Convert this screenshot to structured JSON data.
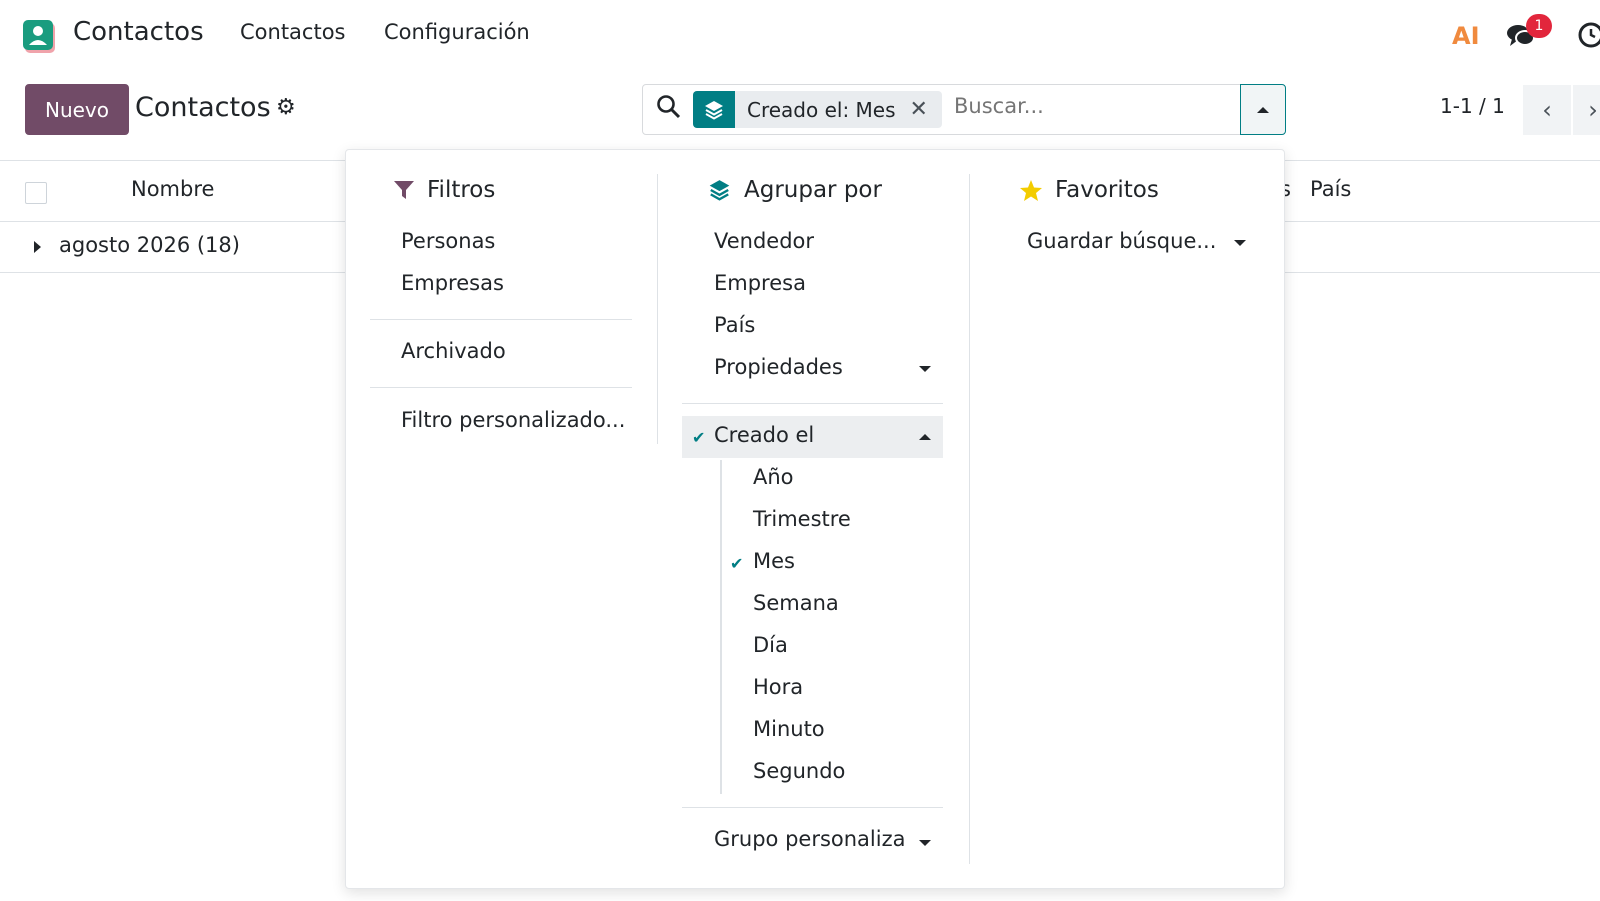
{
  "navbar": {
    "app_title": "Contactos",
    "menu": [
      "Contactos",
      "Configuración"
    ],
    "ai_label": "AI",
    "chat_badge": "1"
  },
  "control_panel": {
    "new_button": "Nuevo",
    "title": "Contactos",
    "search": {
      "facet_label": "Creado el: Mes",
      "placeholder": "Buscar..."
    },
    "pager": "1-1 / 1"
  },
  "list": {
    "columns": [
      "Nombre",
      "s",
      "País"
    ],
    "groups": [
      {
        "label": "agosto 2026 (18)"
      }
    ]
  },
  "dropdown": {
    "filters": {
      "title": "Filtros",
      "items": [
        "Personas",
        "Empresas",
        "Archivado",
        "Filtro personalizado..."
      ]
    },
    "group_by": {
      "title": "Agrupar por",
      "items": [
        "Vendedor",
        "Empresa",
        "País",
        "Propiedades"
      ],
      "selected": "Creado el",
      "sub_options": [
        "Año",
        "Trimestre",
        "Mes",
        "Semana",
        "Día",
        "Hora",
        "Minuto",
        "Segundo"
      ],
      "selected_sub": "Mes",
      "custom": "Grupo personaliza"
    },
    "favorites": {
      "title": "Favoritos",
      "save": "Guardar búsque..."
    }
  },
  "colors": {
    "primary": "#714b67",
    "accent": "#017e84",
    "badge": "#e2263c",
    "star": "#f3cc00"
  }
}
